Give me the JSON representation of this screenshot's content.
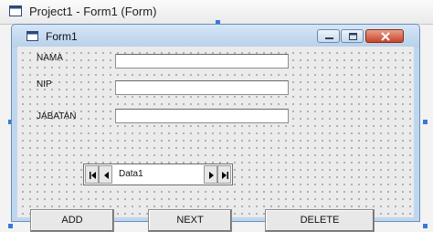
{
  "ide": {
    "window_title": "Project1 - Form1 (Form)"
  },
  "form": {
    "title": "Form1",
    "caption_buttons": [
      "minimize-icon",
      "maximize-icon",
      "close-icon"
    ],
    "fields": [
      {
        "label": "NAMA",
        "value": ""
      },
      {
        "label": "NIP",
        "value": ""
      },
      {
        "label": "JABATAN",
        "value": ""
      }
    ],
    "data_control": {
      "caption": "Data1",
      "icons": [
        "first-record-icon",
        "prev-record-icon",
        "next-record-icon",
        "last-record-icon"
      ]
    },
    "buttons": [
      "ADD",
      "NEXT",
      "DELETE"
    ]
  },
  "colors": {
    "selection_handle": "#3a78d8",
    "form_frame": "#bfd7ee",
    "close_button": "#c8442a"
  }
}
